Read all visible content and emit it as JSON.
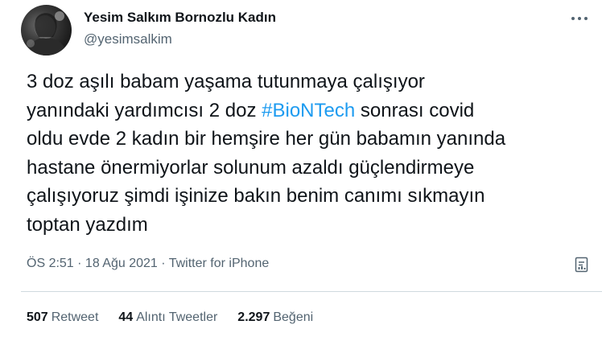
{
  "user": {
    "display_name": "Yesim Salkım Bornozlu Kadın",
    "handle": "@yesimsalkim"
  },
  "tweet": {
    "text_part1": "3 doz aşılı babam yaşama tutunmaya çalışıyor\nyanındaki yardımcısı 2 doz ",
    "hashtag": "#BioNTech",
    "text_part2": " sonrası covid\noldu evde 2 kadın bir hemşire her gün babamın yanında\nhastane önermiyorlar solunum azaldı güçlendirmeye\nçalışıyoruz şimdi işinize bakın benim canımı sıkmayın\ntoptan yazdım"
  },
  "meta": {
    "time": "ÖS 2:51",
    "sep1": " · ",
    "date": "18 Ağu 2021",
    "sep2": " · ",
    "source": "Twitter for iPhone"
  },
  "stats": [
    {
      "count": "507",
      "label": "Retweet"
    },
    {
      "count": "44",
      "label": "Alıntı Tweetler"
    },
    {
      "count": "2.297",
      "label": "Beğeni"
    }
  ],
  "icons": {
    "more": "more-horizontal-icon",
    "analytics": "analytics-icon"
  },
  "colors": {
    "accent": "#1d9bf0",
    "secondary_text": "#536471",
    "primary_text": "#0f1419",
    "divider": "#cfd9de"
  }
}
